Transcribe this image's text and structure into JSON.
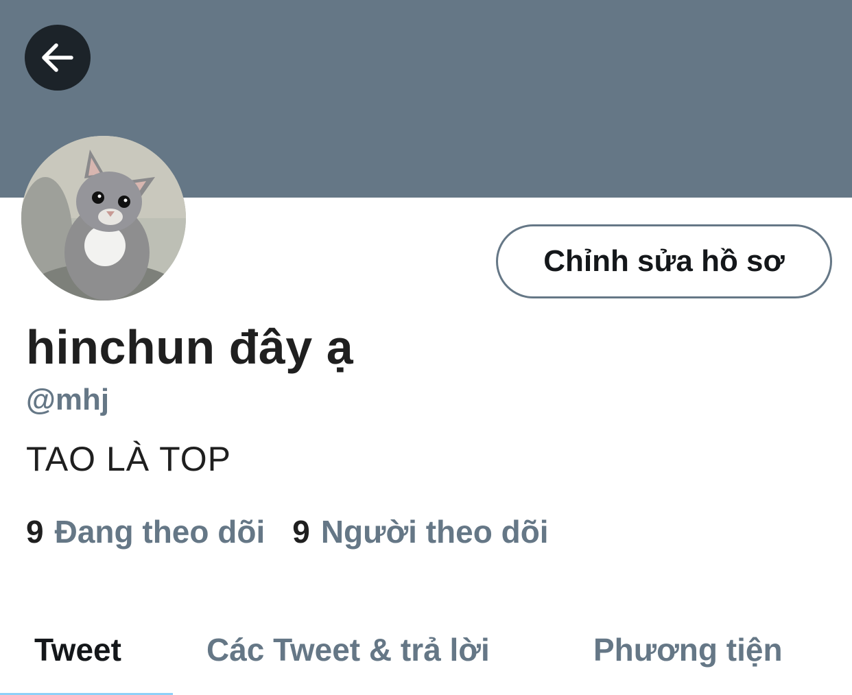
{
  "header": {
    "back_icon": "arrow-left-icon",
    "banner_color": "#657786"
  },
  "profile": {
    "avatar_icon": "cat-avatar",
    "edit_button_label": "Chỉnh sửa hồ sơ",
    "display_name": "hinchun đây ạ",
    "handle": "@mhj",
    "bio": "TAO LÀ TOP",
    "following_count": "9",
    "following_label": "Đang theo dõi",
    "followers_count": "9",
    "followers_label": "Người theo dõi"
  },
  "tabs": [
    {
      "label": "Tweet",
      "active": true
    },
    {
      "label": "Các Tweet & trả lời",
      "active": false
    },
    {
      "label": "Phương tiện",
      "active": false
    }
  ],
  "colors": {
    "accent": "#1da1f2",
    "secondary_text": "#657786",
    "primary_text": "#14171a"
  }
}
